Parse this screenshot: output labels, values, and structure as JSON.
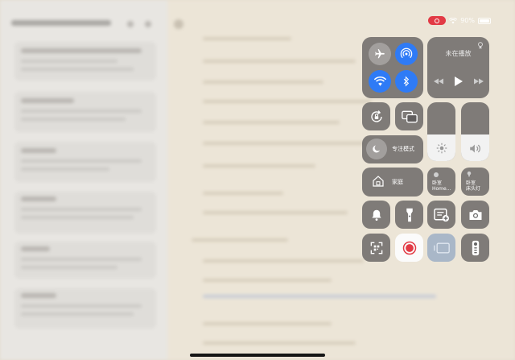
{
  "status_bar": {
    "battery_text": "90%",
    "icons": [
      "screen-recording-icon",
      "wifi-icon",
      "battery-icon"
    ]
  },
  "control_center": {
    "connectivity": {
      "airplane": {
        "icon": "airplane-icon",
        "on": false
      },
      "airdrop": {
        "icon": "airdrop-icon",
        "on": true
      },
      "wifi": {
        "icon": "wifi-icon",
        "on": true
      },
      "bluetooth": {
        "icon": "bluetooth-icon",
        "on": true
      }
    },
    "now_playing": {
      "status": "未在播放",
      "controls": [
        "previous-icon",
        "play-icon",
        "next-icon"
      ],
      "airplay_icon": "airplay-icon"
    },
    "orientation_lock": {
      "icon": "rotation-lock-icon"
    },
    "screen_mirroring": {
      "icon": "screen-mirroring-icon"
    },
    "focus": {
      "label": "专注模式",
      "icon": "moon-icon"
    },
    "brightness": {
      "icon": "sun-icon",
      "level": 0.45
    },
    "volume": {
      "icon": "speaker-icon",
      "level": 0.45
    },
    "home": {
      "label": "家庭",
      "icon": "home-icon"
    },
    "accessories": [
      {
        "room": "卧室",
        "name": "Home...",
        "icon": "light-icon"
      },
      {
        "room": "卧室",
        "name": "床头灯",
        "icon": "bulb-icon"
      }
    ],
    "row_tools": [
      {
        "icon": "bell-icon"
      },
      {
        "icon": "flashlight-icon"
      },
      {
        "icon": "quick-note-icon"
      },
      {
        "icon": "camera-icon"
      }
    ],
    "row_bottom": [
      {
        "icon": "code-scanner-icon"
      },
      {
        "icon": "screen-record-icon"
      },
      {
        "icon": "stage-manager-icon"
      },
      {
        "icon": "apple-tv-remote-icon"
      }
    ]
  },
  "colors": {
    "tile_bg": "#605d5d",
    "accent_blue": "#2f7bf6",
    "record_red": "#e23a45"
  }
}
